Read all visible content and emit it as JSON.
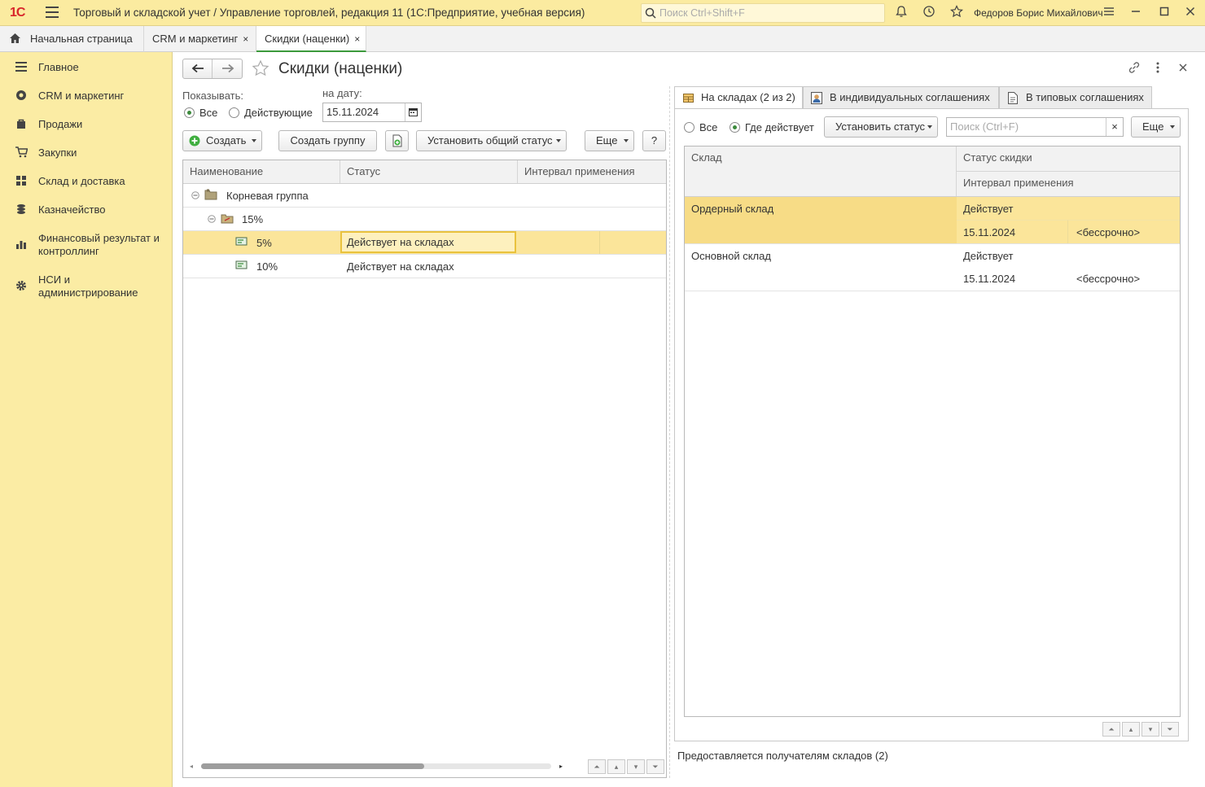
{
  "titlebar": {
    "logo": "1С",
    "title": "Торговый и складской учет / Управление торговлей, редакция 11  (1С:Предприятие, учебная версия)",
    "search_placeholder": "Поиск Ctrl+Shift+F",
    "user": "Федоров Борис Михайлович"
  },
  "tabs": [
    {
      "label": "Начальная страница"
    },
    {
      "label": "CRM и маркетинг",
      "close": "×"
    },
    {
      "label": "Скидки (наценки)",
      "close": "×"
    }
  ],
  "sidebar": {
    "items": [
      {
        "label": "Главное",
        "icon": "menu-icon"
      },
      {
        "label": "CRM и маркетинг",
        "icon": "crm-icon"
      },
      {
        "label": "Продажи",
        "icon": "bag-icon"
      },
      {
        "label": "Закупки",
        "icon": "cart-icon"
      },
      {
        "label": "Склад и доставка",
        "icon": "warehouse-icon"
      },
      {
        "label": "Казначейство",
        "icon": "coins-icon"
      },
      {
        "label": "Финансовый результат и контроллинг",
        "icon": "chart-icon"
      },
      {
        "label": "НСИ и администрирование",
        "icon": "gear-icon"
      }
    ]
  },
  "form": {
    "title": "Скидки (наценки)",
    "show_label": "Показывать:",
    "radio_all": "Все",
    "radio_active": "Действующие",
    "date_label": "на дату:",
    "date_value": "15.11.2024",
    "btn_create": "Создать",
    "btn_create_group": "Создать группу",
    "btn_set_status": "Установить общий статус",
    "btn_more": "Еще",
    "btn_help": "?"
  },
  "left_table": {
    "headers": [
      "Наименование",
      "Статус",
      "Интервал применения"
    ],
    "rows": [
      {
        "name": "Корневая группа",
        "status": ""
      },
      {
        "name": "15%",
        "status": ""
      },
      {
        "name": "5%",
        "status": "Действует на складах"
      },
      {
        "name": "10%",
        "status": "Действует на складах"
      }
    ]
  },
  "right_panel": {
    "tabs": [
      {
        "label": "На складах (2 из 2)"
      },
      {
        "label": "В индивидуальных соглашениях"
      },
      {
        "label": "В типовых соглашениях"
      }
    ],
    "radio_all": "Все",
    "radio_where": "Где действует",
    "btn_set_status": "Установить статус",
    "search_placeholder": "Поиск (Ctrl+F)",
    "search_clear": "×",
    "btn_more": "Еще",
    "headers": {
      "warehouse": "Склад",
      "status": "Статус скидки",
      "interval": "Интервал применения"
    },
    "rows": [
      {
        "warehouse": "Ордерный склад",
        "status": "Действует",
        "from": "15.11.2024",
        "to": "<бессрочно>"
      },
      {
        "warehouse": "Основной склад",
        "status": "Действует",
        "from": "15.11.2024",
        "to": "<бессрочно>"
      }
    ],
    "footer": "Предоставляется получателям складов (2)"
  },
  "colors": {
    "accent": "#fbeca4",
    "selection": "#fbe59a",
    "green": "#3c9a3c",
    "logo_red": "#d8262b"
  }
}
